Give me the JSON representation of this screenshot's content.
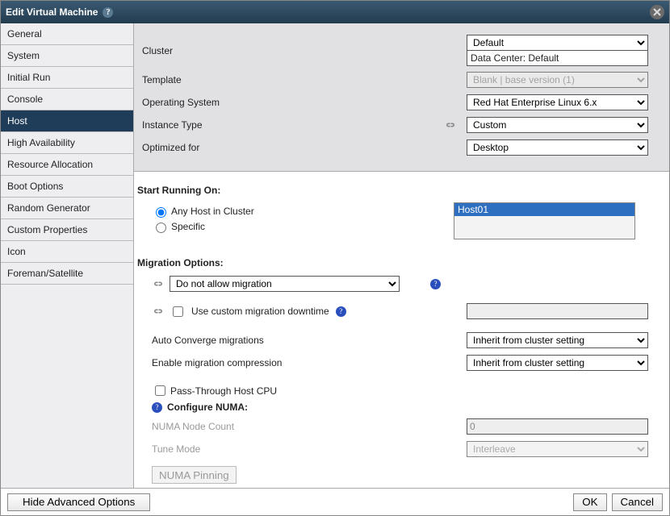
{
  "title": "Edit Virtual Machine",
  "nav": [
    {
      "label": "General"
    },
    {
      "label": "System"
    },
    {
      "label": "Initial Run"
    },
    {
      "label": "Console"
    },
    {
      "label": "Host",
      "active": true
    },
    {
      "label": "High Availability"
    },
    {
      "label": "Resource Allocation"
    },
    {
      "label": "Boot Options"
    },
    {
      "label": "Random Generator"
    },
    {
      "label": "Custom Properties"
    },
    {
      "label": "Icon"
    },
    {
      "label": "Foreman/Satellite"
    }
  ],
  "top": {
    "cluster_label": "Cluster",
    "cluster_value": "Default",
    "datacenter_text": "Data Center: Default",
    "template_label": "Template",
    "template_value": "Blank | base version (1)",
    "os_label": "Operating System",
    "os_value": "Red Hat Enterprise Linux 6.x",
    "instance_label": "Instance Type",
    "instance_value": "Custom",
    "optimized_label": "Optimized for",
    "optimized_value": "Desktop"
  },
  "host": {
    "start_running_on": "Start Running On:",
    "any_host": "Any Host in Cluster",
    "specific": "Specific",
    "host_selected": "Host01",
    "migration_options": "Migration Options:",
    "migration_value": "Do not allow migration",
    "use_custom_downtime": "Use custom migration downtime",
    "auto_converge_label": "Auto Converge migrations",
    "auto_converge_value": "Inherit from cluster setting",
    "enable_compress_label": "Enable migration compression",
    "enable_compress_value": "Inherit from cluster setting",
    "passthrough": "Pass-Through Host CPU",
    "configure_numa": "Configure NUMA:",
    "numa_count_label": "NUMA Node Count",
    "numa_count_value": "0",
    "tune_label": "Tune Mode",
    "tune_value": "Interleave",
    "numa_pinning": "NUMA Pinning"
  },
  "buttons": {
    "adv": "Hide Advanced Options",
    "ok": "OK",
    "cancel": "Cancel"
  }
}
